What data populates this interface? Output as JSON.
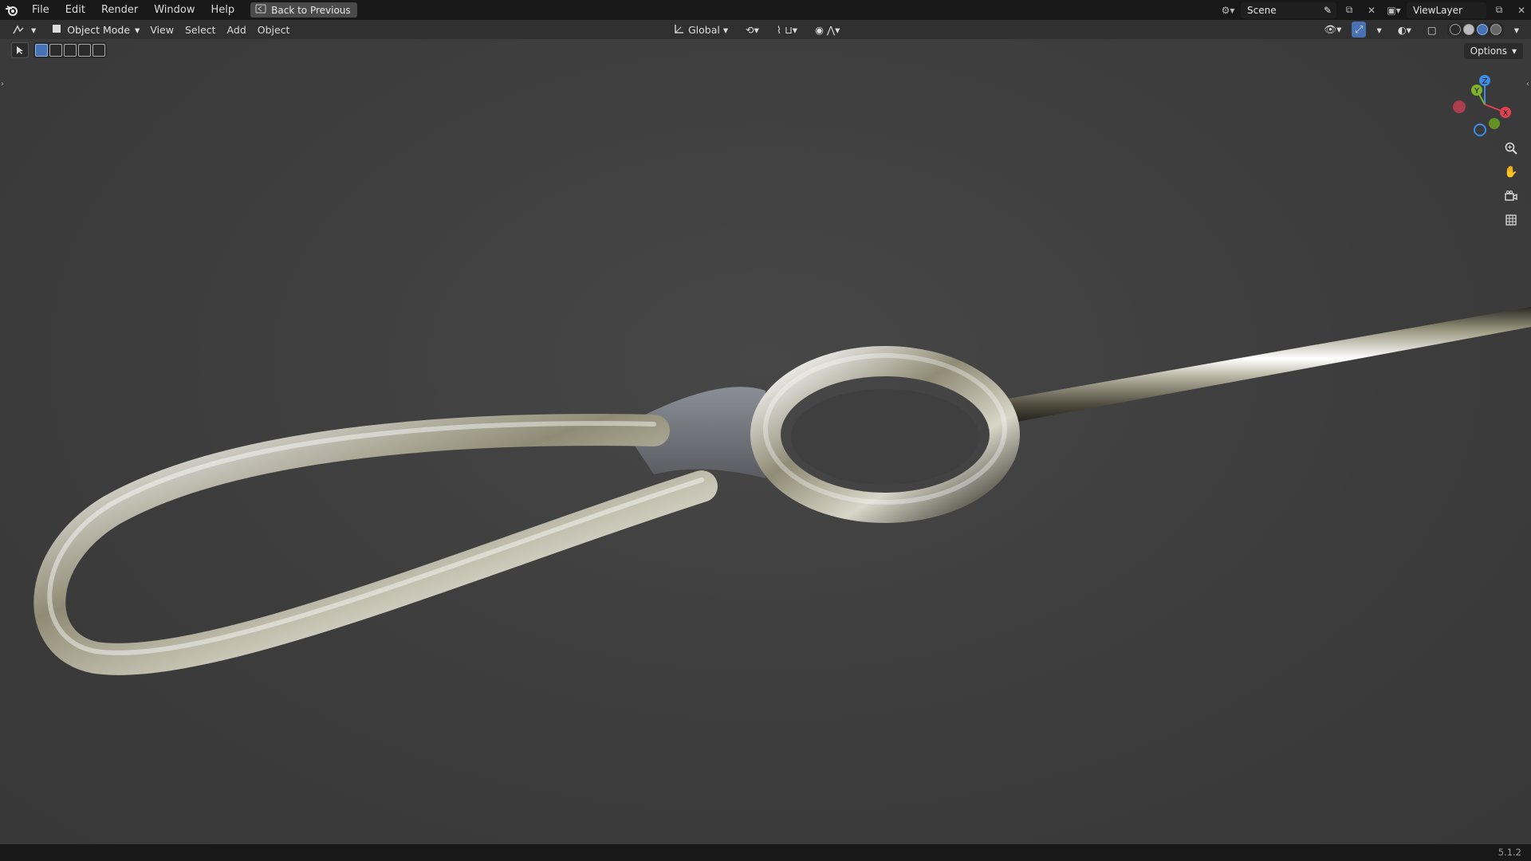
{
  "menu": {
    "items": [
      "File",
      "Edit",
      "Render",
      "Window",
      "Help"
    ],
    "back_button": "Back to Previous"
  },
  "topbar_right": {
    "scene": "Scene",
    "view_layer": "ViewLayer"
  },
  "viewport_header": {
    "mode": "Object Mode",
    "menus": [
      "View",
      "Select",
      "Add",
      "Object"
    ],
    "transform_orientation": "Global"
  },
  "options_label": "Options",
  "status": {
    "version": "5.1.2"
  },
  "colors": {
    "accent": "#4772b3",
    "axis_x": "#e0414f",
    "axis_y": "#7fb32c",
    "axis_z": "#3a8ee6"
  },
  "icons": [
    "blender-logo-icon",
    "back-icon",
    "editor-type-icon",
    "object-mode-icon",
    "orientation-icon",
    "pivot-icon",
    "snap-icon",
    "proportional-icon",
    "visibility-icon",
    "gizmo-icon",
    "overlay-icon",
    "xray-icon",
    "wireframe-icon",
    "solid-icon",
    "material-icon",
    "rendered-icon",
    "zoom-icon",
    "pan-hand-icon",
    "camera-icon",
    "grid-icon"
  ]
}
